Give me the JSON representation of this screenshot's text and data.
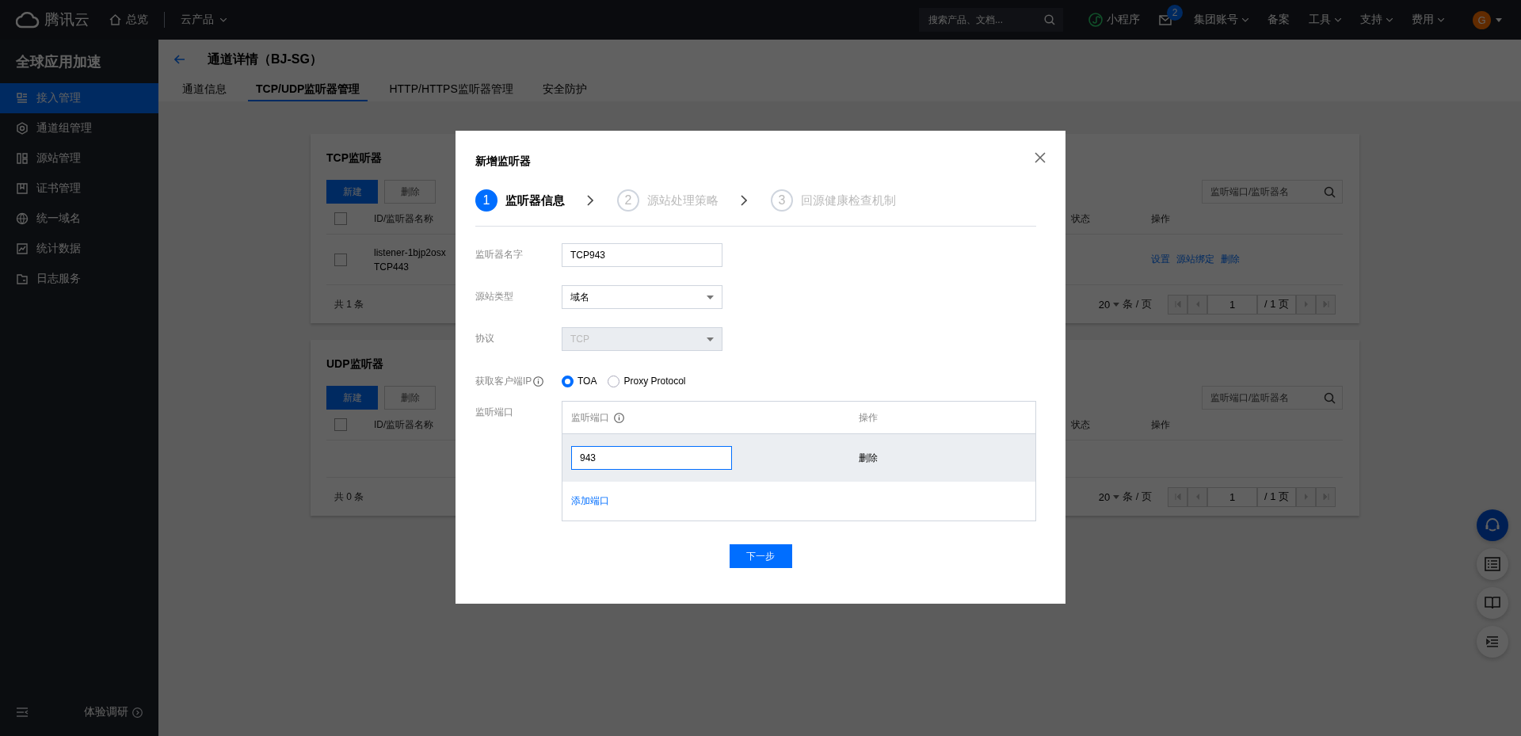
{
  "top_bar": {
    "logo_text": "腾讯云",
    "nav": [
      {
        "label": "总览",
        "kind": "home"
      },
      {
        "label": "云产品",
        "kind": "dropdown"
      }
    ],
    "search": {
      "placeholder": "搜索产品、文档..."
    },
    "links": [
      {
        "label": "小程序",
        "kind": "miniapp"
      },
      {
        "label": "集团账号",
        "kind": "dropdown"
      },
      {
        "label": "备案",
        "kind": "plain"
      },
      {
        "label": "工具",
        "kind": "dropdown"
      },
      {
        "label": "支持",
        "kind": "dropdown"
      },
      {
        "label": "费用",
        "kind": "dropdown"
      }
    ],
    "mail": {
      "badge": "2"
    },
    "avatar": {
      "initial": "G"
    }
  },
  "sidebar": {
    "title": "全球应用加速",
    "items": [
      {
        "label": "接入管理",
        "selected": true
      },
      {
        "label": "通道组管理",
        "selected": false
      },
      {
        "label": "源站管理",
        "selected": false
      },
      {
        "label": "证书管理",
        "selected": false
      },
      {
        "label": "统一域名",
        "selected": false
      },
      {
        "label": "统计数据",
        "selected": false
      },
      {
        "label": "日志服务",
        "selected": false
      }
    ],
    "footer": {
      "label": "体验调研"
    }
  },
  "page": {
    "title": "通道详情（BJ-SG）",
    "tabs": [
      {
        "label": "通道信息",
        "selected": false
      },
      {
        "label": "TCP/UDP监听器管理",
        "selected": true
      },
      {
        "label": "HTTP/HTTPS监听器管理",
        "selected": false
      },
      {
        "label": "安全防护",
        "selected": false
      }
    ]
  },
  "cards": [
    {
      "title": "TCP监听器",
      "buttons": [
        {
          "label": "新建",
          "kind": "primary"
        },
        {
          "label": "删除",
          "kind": "default"
        }
      ],
      "search": {
        "placeholder": "监听端口/监听器名"
      },
      "columns": [
        "ID/监听器名称",
        "状态",
        "操作"
      ],
      "all_checked": false,
      "rows": [
        {
          "checked": false,
          "id": "listener-1bjp2osx",
          "name": "TCP443",
          "actions": [
            "设置",
            "源站绑定",
            "删除"
          ]
        }
      ],
      "footer": {
        "total": "共 1 条",
        "page_size": "20",
        "per_page": "条 / 页",
        "page": "1",
        "pages": "/ 1 页"
      }
    },
    {
      "title": "UDP监听器",
      "buttons": [
        {
          "label": "新建",
          "kind": "primary"
        },
        {
          "label": "删除",
          "kind": "default"
        }
      ],
      "search": {
        "placeholder": "监听端口/监听器名"
      },
      "columns": [
        "ID/监听器名称",
        "状态",
        "操作"
      ],
      "all_checked": false,
      "footer": {
        "total": "共 0 条",
        "page_size": "20",
        "per_page": "条 / 页",
        "page": "1",
        "pages": "/ 1 页"
      }
    }
  ],
  "dialog": {
    "title": "新增监听器",
    "steps": [
      {
        "number": "1",
        "label": "监听器信息",
        "selected": true
      },
      {
        "number": "2",
        "label": "源站处理策略",
        "selected": false
      },
      {
        "number": "3",
        "label": "回源健康检查机制",
        "selected": false
      }
    ],
    "fields": [
      {
        "kind": "text",
        "label": "监听器名字",
        "value": "TCP943"
      },
      {
        "kind": "select",
        "label": "源站类型",
        "value": "域名",
        "disabled": false
      },
      {
        "kind": "select",
        "label": "协议",
        "value": "TCP",
        "disabled": true
      },
      {
        "kind": "radio",
        "label": "获取客户端IP",
        "options": [
          {
            "label": "TOA",
            "selected": true
          },
          {
            "label": "Proxy Protocol",
            "selected": false
          }
        ]
      },
      {
        "kind": "ports",
        "label": "监听端口",
        "columns": [
          "监听端口",
          "操作"
        ],
        "rows": [
          {
            "value": "943",
            "action": "删除"
          }
        ],
        "add_label": "添加端口"
      }
    ],
    "next_button": "下一步"
  }
}
